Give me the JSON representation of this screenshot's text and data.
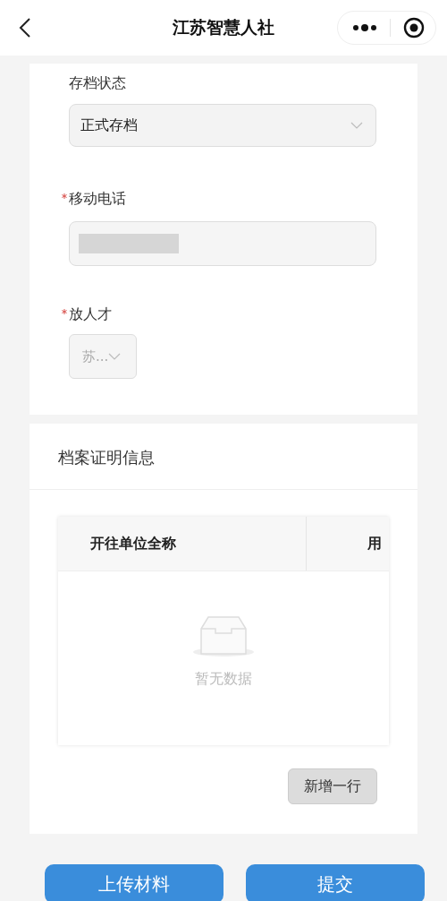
{
  "nav_bar": {
    "title": "江苏智慧人社"
  },
  "form": {
    "fields": [
      {
        "kind": "select",
        "label": "存档状态",
        "required": false,
        "value": "正式存档"
      },
      {
        "kind": "input",
        "label": "移动电话",
        "required": true
      },
      {
        "kind": "small_select",
        "label": "放人才",
        "required": true,
        "value": "苏..."
      }
    ]
  },
  "certificate_section": {
    "title": "档案证明信息",
    "table": {
      "columns": [
        "开往单位全称",
        "用"
      ],
      "empty_text": "暂无数据"
    },
    "add_button": "新增一行"
  },
  "footer_buttons": [
    "上传材料",
    "提交"
  ]
}
